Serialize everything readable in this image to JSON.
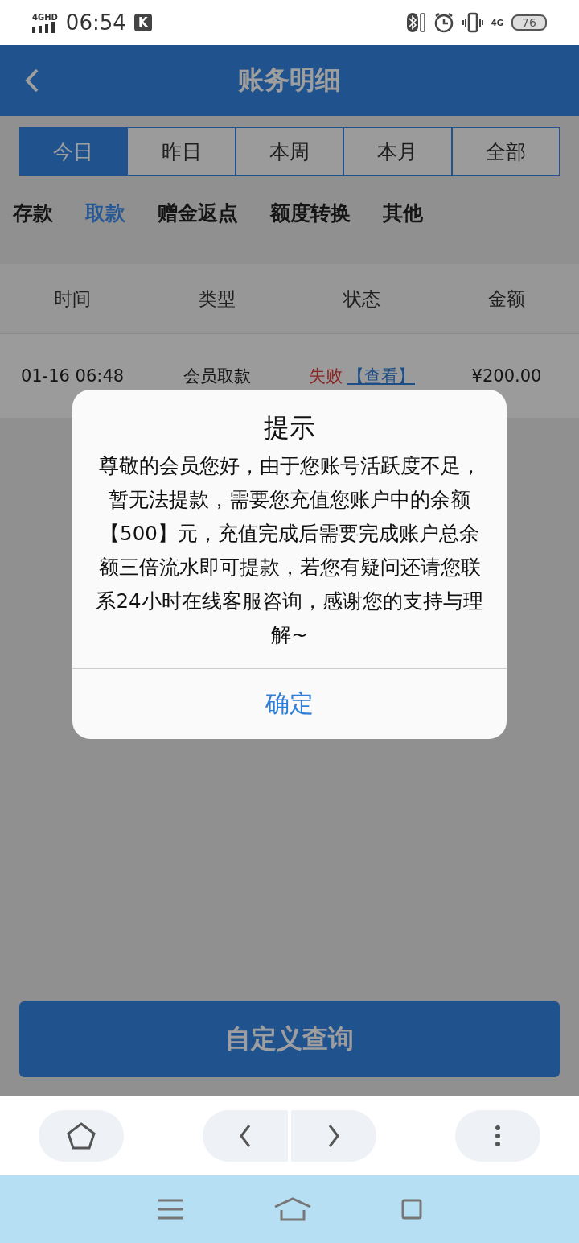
{
  "status_bar": {
    "network_label": "4GHD",
    "time": "06:54",
    "app_badge": "K",
    "mobile_data_label": "4G",
    "battery": "76"
  },
  "header": {
    "title": "账务明细"
  },
  "period_tabs": [
    {
      "label": "今日",
      "selected": true
    },
    {
      "label": "昨日",
      "selected": false
    },
    {
      "label": "本周",
      "selected": false
    },
    {
      "label": "本月",
      "selected": false
    },
    {
      "label": "全部",
      "selected": false
    }
  ],
  "categories": [
    {
      "label": "存款",
      "selected": false
    },
    {
      "label": "取款",
      "selected": true
    },
    {
      "label": "赠金返点",
      "selected": false
    },
    {
      "label": "额度转换",
      "selected": false
    },
    {
      "label": "其他",
      "selected": false
    }
  ],
  "table": {
    "columns": [
      "时间",
      "类型",
      "状态",
      "金额"
    ],
    "rows": [
      {
        "time": "01-16 06:48",
        "type": "会员取款",
        "status": {
          "text": "失败",
          "kind": "failed"
        },
        "link": "【查看】",
        "amount": "¥200.00"
      }
    ]
  },
  "custom_query_button": "自定义查询",
  "dialog": {
    "title": "提示",
    "message": "尊敬的会员您好，由于您账号活跃度不足，暂无法提款，需要您充值您账户中的余额【500】元，充值完成后需要完成账户总余额三倍流水即可提款，若您有疑问还请您联系24小时在线客服咨询，感谢您的支持与理解~",
    "confirm": "确定"
  }
}
